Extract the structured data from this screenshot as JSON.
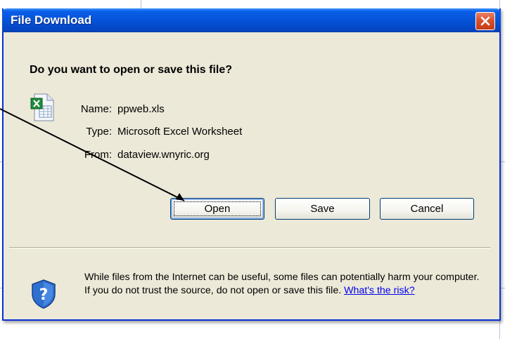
{
  "dialog": {
    "title": "File Download",
    "question": "Do you want to open or save this file?",
    "file": {
      "name_label": "Name:",
      "name_value": "ppweb.xls",
      "type_label": "Type:",
      "type_value": "Microsoft Excel Worksheet",
      "from_label": "From:",
      "from_value": "dataview.wnyric.org",
      "icon": "excel-file-icon"
    },
    "buttons": {
      "open": "Open",
      "save": "Save",
      "cancel": "Cancel"
    },
    "warning": {
      "text": "While files from the Internet can be useful, some files can potentially harm your computer. If you do not trust the source, do not open or save this file.",
      "link": "What's the risk?",
      "icon": "security-shield-icon"
    },
    "colors": {
      "titlebar": "#0553d8",
      "close": "#d8522f",
      "body": "#ece9d8"
    }
  }
}
